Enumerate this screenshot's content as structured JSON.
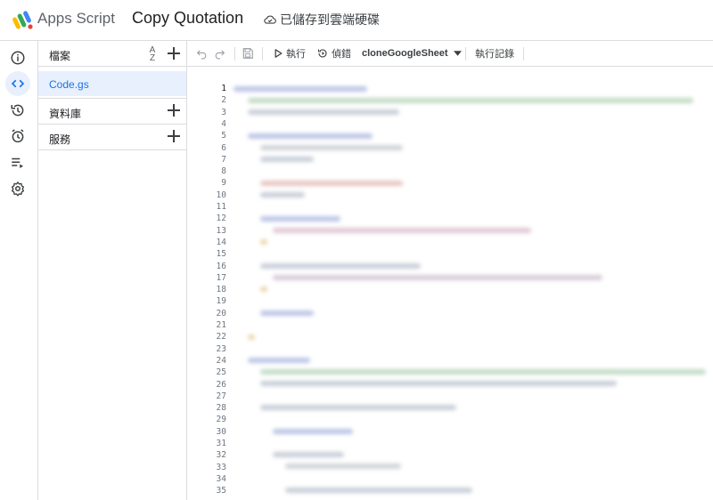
{
  "header": {
    "product_name": "Apps Script",
    "project_name": "Copy Quotation",
    "save_status": "已儲存到雲端硬碟"
  },
  "rail": {
    "items": [
      {
        "icon": "info-icon",
        "active": false
      },
      {
        "icon": "code-icon",
        "active": true
      },
      {
        "icon": "history-icon",
        "active": false
      },
      {
        "icon": "alarm-icon",
        "active": false
      },
      {
        "icon": "executions-icon",
        "active": false
      },
      {
        "icon": "gear-icon",
        "active": false
      }
    ]
  },
  "files_panel": {
    "title": "檔案",
    "sort_label_top": "A",
    "sort_label_bottom": "Z",
    "files": [
      {
        "name": "Code.gs",
        "selected": true
      }
    ],
    "sections": [
      {
        "label": "資料庫"
      },
      {
        "label": "服務"
      }
    ]
  },
  "toolbar": {
    "run_label": "執行",
    "debug_label": "偵錯",
    "function_name": "cloneGoogleSheet",
    "log_label": "執行記錄"
  },
  "editor": {
    "line_numbers": [
      "1",
      "2",
      "3",
      "4",
      "5",
      "6",
      "7",
      "8",
      "9",
      "10",
      "11",
      "12",
      "13",
      "14",
      "15",
      "16",
      "17",
      "18",
      "19",
      "20",
      "21",
      "22",
      "23",
      "24",
      "25",
      "26",
      "27",
      "28",
      "29",
      "30",
      "31",
      "32",
      "33",
      "34",
      "35"
    ],
    "current_line": "1"
  },
  "colors": {
    "accent": "#1a73e8",
    "selection": "#e8f0fe",
    "border": "#dadce0"
  }
}
